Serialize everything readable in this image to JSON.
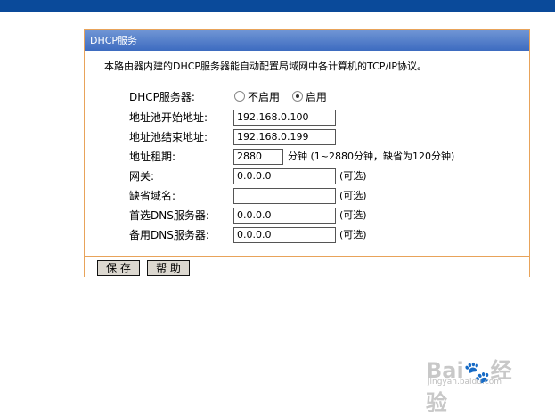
{
  "panel": {
    "title": "DHCP服务",
    "intro": "本路由器内建的DHCP服务器能自动配置局域网中各计算机的TCP/IP协议。"
  },
  "dhcp_server": {
    "label": "DHCP服务器:",
    "options": [
      "不启用",
      "启用"
    ],
    "selected": "启用"
  },
  "fields": {
    "start_ip": {
      "label": "地址池开始地址:",
      "value": "192.168.0.100"
    },
    "end_ip": {
      "label": "地址池结束地址:",
      "value": "192.168.0.199"
    },
    "lease": {
      "label": "地址租期:",
      "value": "2880",
      "note": "分钟 (1~2880分钟，缺省为120分钟)"
    },
    "gateway": {
      "label": "网关:",
      "value": "0.0.0.0",
      "note": "(可选)"
    },
    "domain": {
      "label": "缺省域名:",
      "value": "",
      "note": "(可选)"
    },
    "dns1": {
      "label": "首选DNS服务器:",
      "value": "0.0.0.0",
      "note": "(可选)"
    },
    "dns2": {
      "label": "备用DNS服务器:",
      "value": "0.0.0.0",
      "note": "(可选)"
    }
  },
  "buttons": {
    "save": "保 存",
    "help": "帮 助"
  },
  "watermark": {
    "brand": "Bai",
    "suffix": "经验",
    "url": "jingyan.baidu.com"
  },
  "colors": {
    "top_bar": "#0a4a9a",
    "panel_border": "#e8a35a",
    "header_gradient": "#3d6bc0"
  }
}
